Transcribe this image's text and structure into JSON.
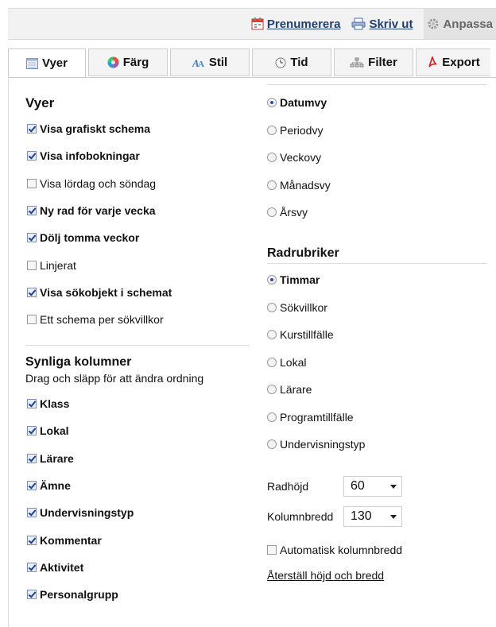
{
  "toplinks": {
    "subscribe": "Prenumerera",
    "print": "Skriv ut",
    "customize": "Anpassa"
  },
  "tabs": [
    {
      "label": "Vyer",
      "icon": "list-view-icon"
    },
    {
      "label": "Färg",
      "icon": "color-wheel-icon"
    },
    {
      "label": "Stil",
      "icon": "text-style-icon"
    },
    {
      "label": "Tid",
      "icon": "clock-icon"
    },
    {
      "label": "Filter",
      "icon": "filter-icon"
    },
    {
      "label": "Export",
      "icon": "pdf-icon"
    }
  ],
  "views": {
    "heading": "Vyer",
    "items": [
      {
        "label": "Visa grafiskt schema",
        "checked": true
      },
      {
        "label": "Visa infobokningar",
        "checked": true
      },
      {
        "label": "Visa lördag och söndag",
        "checked": false
      },
      {
        "label": "Ny rad för varje vecka",
        "checked": true
      },
      {
        "label": "Dölj tomma veckor",
        "checked": true
      },
      {
        "label": "Linjerat",
        "checked": false
      },
      {
        "label": "Visa sökobjekt i schemat",
        "checked": true
      },
      {
        "label": "Ett schema per sökvillkor",
        "checked": false
      }
    ]
  },
  "columns": {
    "heading": "Synliga kolumner",
    "hint": "Drag och släpp för att ändra ordning",
    "items": [
      {
        "label": "Klass",
        "checked": true
      },
      {
        "label": "Lokal",
        "checked": true
      },
      {
        "label": "Lärare",
        "checked": true
      },
      {
        "label": "Ämne",
        "checked": true
      },
      {
        "label": "Undervisningstyp",
        "checked": true
      },
      {
        "label": "Kommentar",
        "checked": true
      },
      {
        "label": "Aktivitet",
        "checked": true
      },
      {
        "label": "Personalgrupp",
        "checked": true
      }
    ]
  },
  "dateviews": {
    "items": [
      {
        "label": "Datumvy",
        "selected": true
      },
      {
        "label": "Periodvy",
        "selected": false
      },
      {
        "label": "Veckovy",
        "selected": false
      },
      {
        "label": "Månadsvy",
        "selected": false
      },
      {
        "label": "Årsvy",
        "selected": false
      }
    ]
  },
  "rowheaders": {
    "heading": "Radrubriker",
    "items": [
      {
        "label": "Timmar",
        "selected": true
      },
      {
        "label": "Sökvillkor",
        "selected": false
      },
      {
        "label": "Kurstillfälle",
        "selected": false
      },
      {
        "label": "Lokal",
        "selected": false
      },
      {
        "label": "Lärare",
        "selected": false
      },
      {
        "label": "Programtillfälle",
        "selected": false
      },
      {
        "label": "Undervisningstyp",
        "selected": false
      }
    ]
  },
  "sizing": {
    "row_height_label": "Radhöjd",
    "row_height_value": "60",
    "col_width_label": "Kolumnbredd",
    "col_width_value": "130",
    "auto_width_label": "Automatisk kolumnbredd",
    "auto_width_checked": false,
    "reset_link": "Återställ höjd och bredd"
  }
}
